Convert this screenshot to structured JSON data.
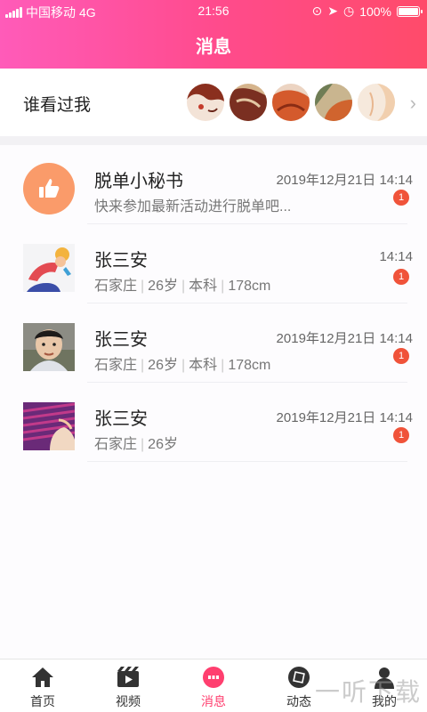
{
  "status": {
    "carrier": "中国移动",
    "network": "4G",
    "time": "21:56",
    "battery": "100%"
  },
  "header": {
    "title": "消息"
  },
  "viewed": {
    "label": "谁看过我"
  },
  "messages": [
    {
      "name": "脱单小秘书",
      "time": "2019年12月21日 14:14",
      "preview": "快来参加最新活动进行脱单吧...",
      "badge": "1"
    },
    {
      "name": "张三安",
      "time": "14:14",
      "city": "石家庄",
      "age": "26岁",
      "edu": "本科",
      "height": "178cm",
      "badge": "1"
    },
    {
      "name": "张三安",
      "time": "2019年12月21日 14:14",
      "city": "石家庄",
      "age": "26岁",
      "edu": "本科",
      "height": "178cm",
      "badge": "1"
    },
    {
      "name": "张三安",
      "time": "2019年12月21日 14:14",
      "city": "石家庄",
      "age": "26岁",
      "badge": "1"
    }
  ],
  "tabs": [
    {
      "label": "首页",
      "icon": "home-icon"
    },
    {
      "label": "视频",
      "icon": "video-icon"
    },
    {
      "label": "消息",
      "icon": "message-icon"
    },
    {
      "label": "动态",
      "icon": "moments-icon"
    },
    {
      "label": "我的",
      "icon": "profile-icon"
    }
  ],
  "watermark": "一听下载",
  "colors": {
    "accent": "#ff3f6f",
    "badge": "#f0533a",
    "header_start": "#ff5bb9",
    "header_end": "#ff4b6a"
  }
}
